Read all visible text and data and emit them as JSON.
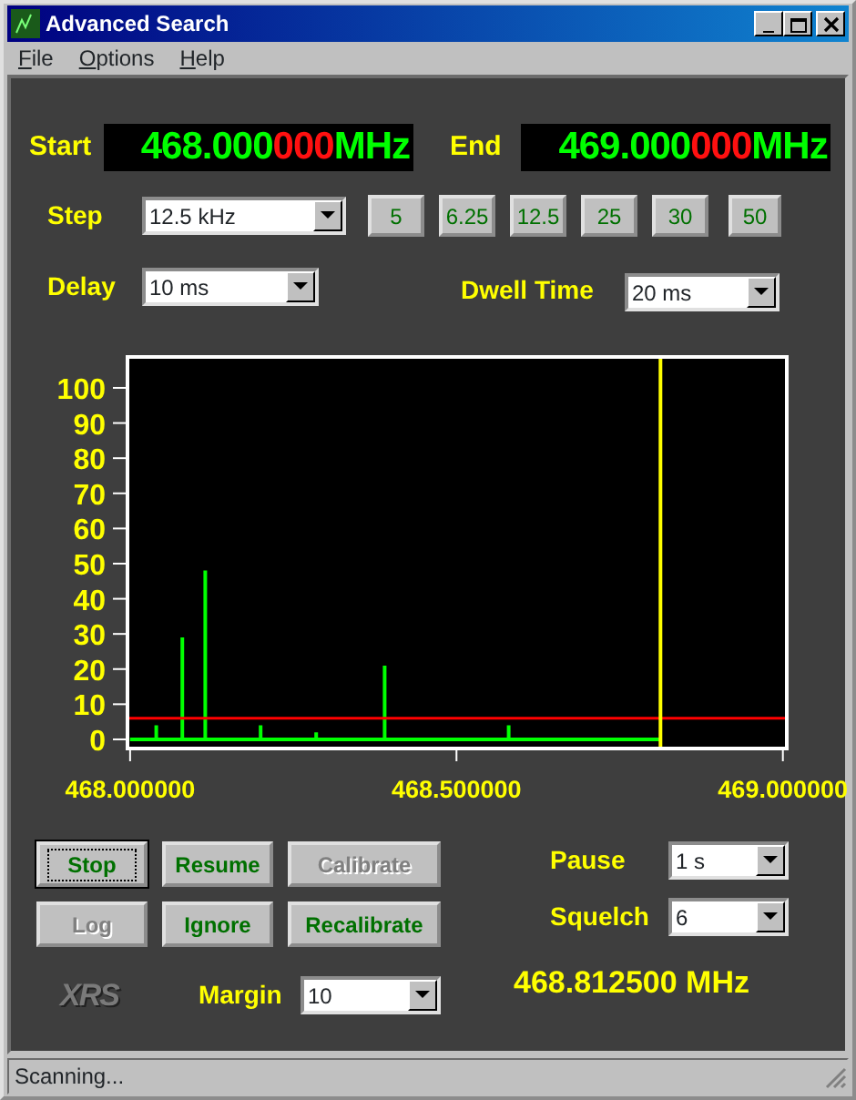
{
  "window": {
    "title": "Advanced Search"
  },
  "menu": [
    {
      "label": "File"
    },
    {
      "label": "Options"
    },
    {
      "label": "Help"
    }
  ],
  "start": {
    "label": "Start",
    "value_main": "468.000",
    "value_fine": "000",
    "unit": "MHz"
  },
  "end": {
    "label": "End",
    "value_main": "469.000",
    "value_fine": "000",
    "unit": "MHz"
  },
  "step": {
    "label": "Step",
    "value": "12.5 kHz",
    "presets": [
      {
        "label": "5"
      },
      {
        "label": "6.25"
      },
      {
        "label": "12.5"
      },
      {
        "label": "25"
      },
      {
        "label": "30"
      },
      {
        "label": "50"
      }
    ]
  },
  "delay": {
    "label": "Delay",
    "value": "10 ms"
  },
  "dwell_time": {
    "label": "Dwell Time",
    "value": "20 ms"
  },
  "chart_data": {
    "type": "line",
    "x": [
      468,
      468.04,
      468.04,
      468.04,
      468.08,
      468.08,
      468.08,
      468.115,
      468.115,
      468.115,
      468.2,
      468.2,
      468.2,
      468.285,
      468.285,
      468.285,
      468.39,
      468.39,
      468.39,
      468.58,
      468.58,
      468.58,
      468.8125
    ],
    "values": [
      0,
      0,
      4,
      0,
      0,
      29,
      0,
      0,
      48,
      0,
      0,
      4,
      0,
      0,
      2,
      0,
      0,
      21,
      0,
      0,
      4,
      0,
      0
    ],
    "xlim": [
      467.996,
      469.006
    ],
    "ylim": [
      -2.6,
      108.8
    ],
    "xticks": [
      {
        "value": 468,
        "label": "468.000000"
      },
      {
        "value": 468.5,
        "label": "468.500000"
      },
      {
        "value": 469,
        "label": "469.000000"
      }
    ],
    "yticks": [
      0,
      10,
      20,
      30,
      40,
      50,
      60,
      70,
      80,
      90,
      100
    ],
    "ref_lines": [
      {
        "axis": "y",
        "value": 6,
        "color": "#ff0000"
      },
      {
        "axis": "x",
        "value": 468.8125,
        "color": "#ffff00"
      }
    ]
  },
  "button_rows": [
    [
      {
        "label": "Stop",
        "disabled": false,
        "default": true
      },
      {
        "label": "Resume",
        "disabled": false,
        "default": false
      },
      {
        "label": "Calibrate",
        "disabled": true,
        "default": false
      }
    ],
    [
      {
        "label": "Log",
        "disabled": true,
        "default": false
      },
      {
        "label": "Ignore",
        "disabled": false,
        "default": false
      },
      {
        "label": "Recalibrate",
        "disabled": false,
        "default": false
      }
    ]
  ],
  "pause": {
    "label": "Pause",
    "value": "1 s"
  },
  "squelch": {
    "label": "Squelch",
    "value": "6"
  },
  "logo": "XRS",
  "margin": {
    "label": "Margin",
    "value": "10"
  },
  "current_frequency": "468.812500 MHz",
  "status_bar": "Scanning..."
}
